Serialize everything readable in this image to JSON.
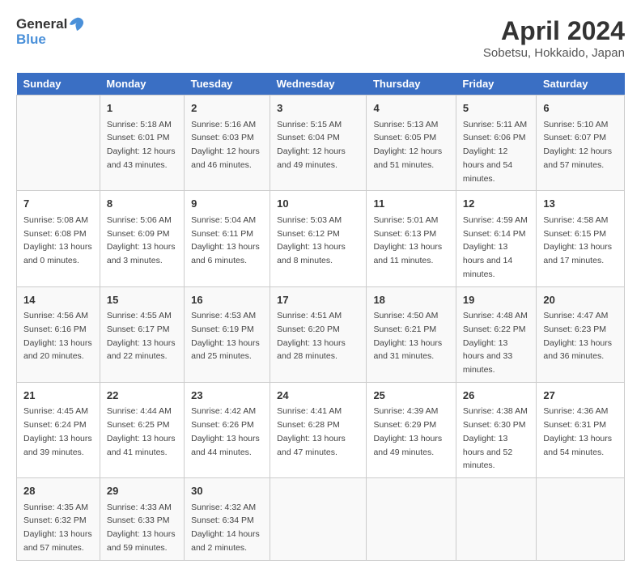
{
  "logo": {
    "line1": "General",
    "line2": "Blue"
  },
  "title": "April 2024",
  "subtitle": "Sobetsu, Hokkaido, Japan",
  "headers": [
    "Sunday",
    "Monday",
    "Tuesday",
    "Wednesday",
    "Thursday",
    "Friday",
    "Saturday"
  ],
  "weeks": [
    [
      {
        "day": "",
        "sunrise": "",
        "sunset": "",
        "daylight": ""
      },
      {
        "day": "1",
        "sunrise": "Sunrise: 5:18 AM",
        "sunset": "Sunset: 6:01 PM",
        "daylight": "Daylight: 12 hours and 43 minutes."
      },
      {
        "day": "2",
        "sunrise": "Sunrise: 5:16 AM",
        "sunset": "Sunset: 6:03 PM",
        "daylight": "Daylight: 12 hours and 46 minutes."
      },
      {
        "day": "3",
        "sunrise": "Sunrise: 5:15 AM",
        "sunset": "Sunset: 6:04 PM",
        "daylight": "Daylight: 12 hours and 49 minutes."
      },
      {
        "day": "4",
        "sunrise": "Sunrise: 5:13 AM",
        "sunset": "Sunset: 6:05 PM",
        "daylight": "Daylight: 12 hours and 51 minutes."
      },
      {
        "day": "5",
        "sunrise": "Sunrise: 5:11 AM",
        "sunset": "Sunset: 6:06 PM",
        "daylight": "Daylight: 12 hours and 54 minutes."
      },
      {
        "day": "6",
        "sunrise": "Sunrise: 5:10 AM",
        "sunset": "Sunset: 6:07 PM",
        "daylight": "Daylight: 12 hours and 57 minutes."
      }
    ],
    [
      {
        "day": "7",
        "sunrise": "Sunrise: 5:08 AM",
        "sunset": "Sunset: 6:08 PM",
        "daylight": "Daylight: 13 hours and 0 minutes."
      },
      {
        "day": "8",
        "sunrise": "Sunrise: 5:06 AM",
        "sunset": "Sunset: 6:09 PM",
        "daylight": "Daylight: 13 hours and 3 minutes."
      },
      {
        "day": "9",
        "sunrise": "Sunrise: 5:04 AM",
        "sunset": "Sunset: 6:11 PM",
        "daylight": "Daylight: 13 hours and 6 minutes."
      },
      {
        "day": "10",
        "sunrise": "Sunrise: 5:03 AM",
        "sunset": "Sunset: 6:12 PM",
        "daylight": "Daylight: 13 hours and 8 minutes."
      },
      {
        "day": "11",
        "sunrise": "Sunrise: 5:01 AM",
        "sunset": "Sunset: 6:13 PM",
        "daylight": "Daylight: 13 hours and 11 minutes."
      },
      {
        "day": "12",
        "sunrise": "Sunrise: 4:59 AM",
        "sunset": "Sunset: 6:14 PM",
        "daylight": "Daylight: 13 hours and 14 minutes."
      },
      {
        "day": "13",
        "sunrise": "Sunrise: 4:58 AM",
        "sunset": "Sunset: 6:15 PM",
        "daylight": "Daylight: 13 hours and 17 minutes."
      }
    ],
    [
      {
        "day": "14",
        "sunrise": "Sunrise: 4:56 AM",
        "sunset": "Sunset: 6:16 PM",
        "daylight": "Daylight: 13 hours and 20 minutes."
      },
      {
        "day": "15",
        "sunrise": "Sunrise: 4:55 AM",
        "sunset": "Sunset: 6:17 PM",
        "daylight": "Daylight: 13 hours and 22 minutes."
      },
      {
        "day": "16",
        "sunrise": "Sunrise: 4:53 AM",
        "sunset": "Sunset: 6:19 PM",
        "daylight": "Daylight: 13 hours and 25 minutes."
      },
      {
        "day": "17",
        "sunrise": "Sunrise: 4:51 AM",
        "sunset": "Sunset: 6:20 PM",
        "daylight": "Daylight: 13 hours and 28 minutes."
      },
      {
        "day": "18",
        "sunrise": "Sunrise: 4:50 AM",
        "sunset": "Sunset: 6:21 PM",
        "daylight": "Daylight: 13 hours and 31 minutes."
      },
      {
        "day": "19",
        "sunrise": "Sunrise: 4:48 AM",
        "sunset": "Sunset: 6:22 PM",
        "daylight": "Daylight: 13 hours and 33 minutes."
      },
      {
        "day": "20",
        "sunrise": "Sunrise: 4:47 AM",
        "sunset": "Sunset: 6:23 PM",
        "daylight": "Daylight: 13 hours and 36 minutes."
      }
    ],
    [
      {
        "day": "21",
        "sunrise": "Sunrise: 4:45 AM",
        "sunset": "Sunset: 6:24 PM",
        "daylight": "Daylight: 13 hours and 39 minutes."
      },
      {
        "day": "22",
        "sunrise": "Sunrise: 4:44 AM",
        "sunset": "Sunset: 6:25 PM",
        "daylight": "Daylight: 13 hours and 41 minutes."
      },
      {
        "day": "23",
        "sunrise": "Sunrise: 4:42 AM",
        "sunset": "Sunset: 6:26 PM",
        "daylight": "Daylight: 13 hours and 44 minutes."
      },
      {
        "day": "24",
        "sunrise": "Sunrise: 4:41 AM",
        "sunset": "Sunset: 6:28 PM",
        "daylight": "Daylight: 13 hours and 47 minutes."
      },
      {
        "day": "25",
        "sunrise": "Sunrise: 4:39 AM",
        "sunset": "Sunset: 6:29 PM",
        "daylight": "Daylight: 13 hours and 49 minutes."
      },
      {
        "day": "26",
        "sunrise": "Sunrise: 4:38 AM",
        "sunset": "Sunset: 6:30 PM",
        "daylight": "Daylight: 13 hours and 52 minutes."
      },
      {
        "day": "27",
        "sunrise": "Sunrise: 4:36 AM",
        "sunset": "Sunset: 6:31 PM",
        "daylight": "Daylight: 13 hours and 54 minutes."
      }
    ],
    [
      {
        "day": "28",
        "sunrise": "Sunrise: 4:35 AM",
        "sunset": "Sunset: 6:32 PM",
        "daylight": "Daylight: 13 hours and 57 minutes."
      },
      {
        "day": "29",
        "sunrise": "Sunrise: 4:33 AM",
        "sunset": "Sunset: 6:33 PM",
        "daylight": "Daylight: 13 hours and 59 minutes."
      },
      {
        "day": "30",
        "sunrise": "Sunrise: 4:32 AM",
        "sunset": "Sunset: 6:34 PM",
        "daylight": "Daylight: 14 hours and 2 minutes."
      },
      {
        "day": "",
        "sunrise": "",
        "sunset": "",
        "daylight": ""
      },
      {
        "day": "",
        "sunrise": "",
        "sunset": "",
        "daylight": ""
      },
      {
        "day": "",
        "sunrise": "",
        "sunset": "",
        "daylight": ""
      },
      {
        "day": "",
        "sunrise": "",
        "sunset": "",
        "daylight": ""
      }
    ]
  ]
}
